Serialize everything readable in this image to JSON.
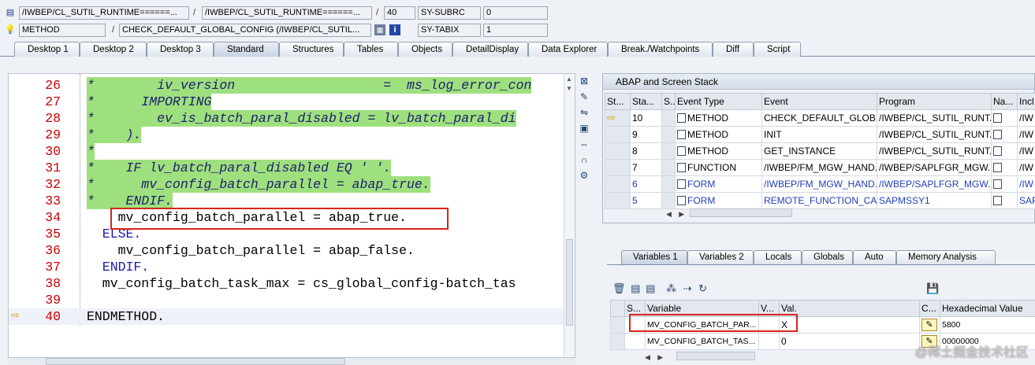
{
  "header": {
    "row1": {
      "field1": "/IWBEP/CL_SUTIL_RUNTIME======...",
      "field2": "/IWBEP/CL_SUTIL_RUNTIME======...",
      "line": "40",
      "sysvar": "SY-SUBRC",
      "sysval": "0"
    },
    "row2": {
      "type": "METHOD",
      "name": "CHECK_DEFAULT_GLOBAL_CONFIG (/IWBEP/CL_SUTIL...",
      "sysvar": "SY-TABIX",
      "sysval": "1"
    }
  },
  "tabs": [
    "Desktop 1",
    "Desktop 2",
    "Desktop 3",
    "Standard",
    "Structures",
    "Tables",
    "Objects",
    "DetailDisplay",
    "Data Explorer",
    "Break./Watchpoints",
    "Diff",
    "Script"
  ],
  "code": [
    {
      "n": "26",
      "t": "*        iv_version                   =  ms_log_error_con"
    },
    {
      "n": "27",
      "t": "*      IMPORTING"
    },
    {
      "n": "28",
      "t": "*        ev_is_batch_paral_disabled = lv_batch_paral_di"
    },
    {
      "n": "29",
      "t": "*    )."
    },
    {
      "n": "30",
      "t": "*"
    },
    {
      "n": "31",
      "t": "*    IF lv_batch_paral_disabled EQ ' '."
    },
    {
      "n": "32",
      "t": "*      mv_config_batch_parallel = abap_true."
    },
    {
      "n": "33",
      "t": "*    ENDIF."
    },
    {
      "n": "34",
      "t": "    mv_config_batch_parallel = abap_true."
    },
    {
      "n": "35",
      "t": "  ELSE."
    },
    {
      "n": "36",
      "t": "    mv_config_batch_parallel = abap_false."
    },
    {
      "n": "37",
      "t": "  ENDIF."
    },
    {
      "n": "38",
      "t": "  mv_config_batch_task_max = cs_global_config-batch_tas"
    },
    {
      "n": "39",
      "t": ""
    },
    {
      "n": "40",
      "t": "ENDMETHOD."
    }
  ],
  "stack": {
    "title": "ABAP and Screen Stack",
    "columns": [
      "St...",
      "Sta...",
      "S...",
      "Event Type",
      "Event",
      "Program",
      "Na...",
      "Incl"
    ],
    "rows": [
      {
        "sta": "10",
        "type": "METHOD",
        "event": "CHECK_DEFAULT_GLOB...",
        "program": "/IWBEP/CL_SUTIL_RUNT...",
        "incl": "/IW"
      },
      {
        "sta": "9",
        "type": "METHOD",
        "event": "INIT",
        "program": "/IWBEP/CL_SUTIL_RUNT...",
        "incl": "/IW"
      },
      {
        "sta": "8",
        "type": "METHOD",
        "event": "GET_INSTANCE",
        "program": "/IWBEP/CL_SUTIL_RUNT...",
        "incl": "/IW"
      },
      {
        "sta": "7",
        "type": "FUNCTION",
        "event": "/IWBEP/FM_MGW_HAND...",
        "program": "/IWBEP/SAPLFGR_MGW...",
        "incl": "/IW"
      },
      {
        "sta": "6",
        "type": "FORM",
        "event": "/IWBEP/FM_MGW_HAND...",
        "program": "/IWBEP/SAPLFGR_MGW...",
        "incl": "/IW"
      },
      {
        "sta": "5",
        "type": "FORM",
        "event": "REMOTE_FUNCTION_CA...",
        "program": "SAPMSSY1",
        "incl": "SAP"
      }
    ]
  },
  "vartabs": [
    "Variables 1",
    "Variables 2",
    "Locals",
    "Globals",
    "Auto",
    "Memory Analysis"
  ],
  "vars": {
    "columns": [
      "S...",
      "Variable",
      "V...",
      "Val.",
      "C...",
      "Hexadecimal Value"
    ],
    "rows": [
      {
        "name": "MV_CONFIG_BATCH_PAR...",
        "val": "X",
        "hex": "5800"
      },
      {
        "name": "MV_CONFIG_BATCH_TAS...",
        "val": "0",
        "hex": "00000000"
      }
    ]
  },
  "watermark": "@稀土掘金技术社区"
}
